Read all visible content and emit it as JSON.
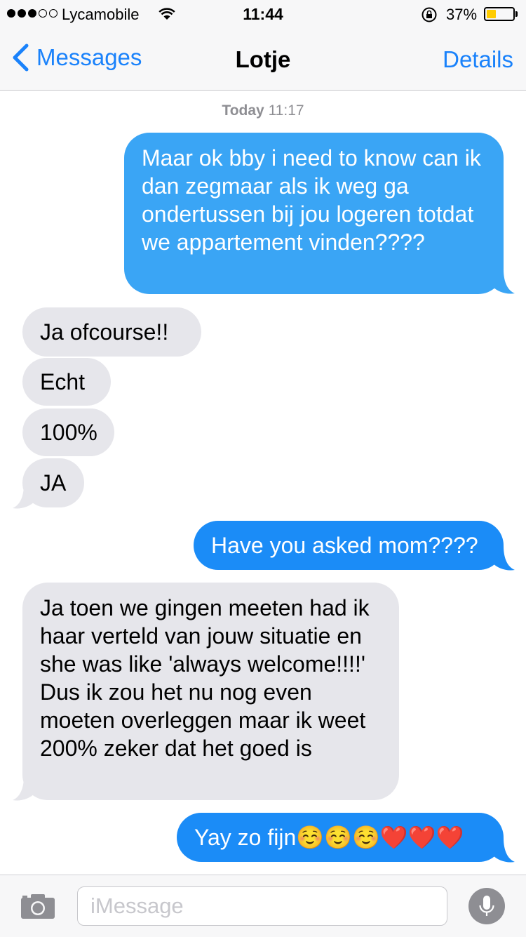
{
  "status_bar": {
    "carrier": "Lycamobile",
    "signal_bars": 3,
    "signal_total": 5,
    "time": "11:44",
    "battery_percent": "37%",
    "battery_level": 0.37,
    "battery_color": "#ffcc00"
  },
  "nav": {
    "back_label": "Messages",
    "title": "Lotje",
    "details_label": "Details"
  },
  "thread": {
    "timestamp_day": "Today",
    "timestamp_time": "11:17",
    "messages": [
      {
        "direction": "outgoing",
        "text": "Maar ok bby i need to know can ik dan zegmaar als ik weg ga ondertussen bij jou logeren totdat we appartement vinden????"
      },
      {
        "direction": "incoming",
        "text": "Ja ofcourse!!"
      },
      {
        "direction": "incoming",
        "text": "Echt"
      },
      {
        "direction": "incoming",
        "text": "100%"
      },
      {
        "direction": "incoming",
        "text": "JA"
      },
      {
        "direction": "outgoing",
        "text": "Have you asked mom????"
      },
      {
        "direction": "incoming",
        "text": "Ja toen we gingen meeten had ik haar verteld van jouw situatie en she was like 'always welcome!!!!' Dus ik zou het nu nog even moeten overleggen maar ik weet 200% zeker dat het goed is"
      },
      {
        "direction": "outgoing",
        "text": "Yay zo fijn",
        "emojis": "☺️☺️☺️❤️❤️❤️"
      }
    ],
    "outgoing_color": "#1b8cf7",
    "incoming_color": "#e6e6eb"
  },
  "input_bar": {
    "placeholder": "iMessage",
    "camera_icon": "camera-icon",
    "mic_icon": "microphone-icon"
  }
}
